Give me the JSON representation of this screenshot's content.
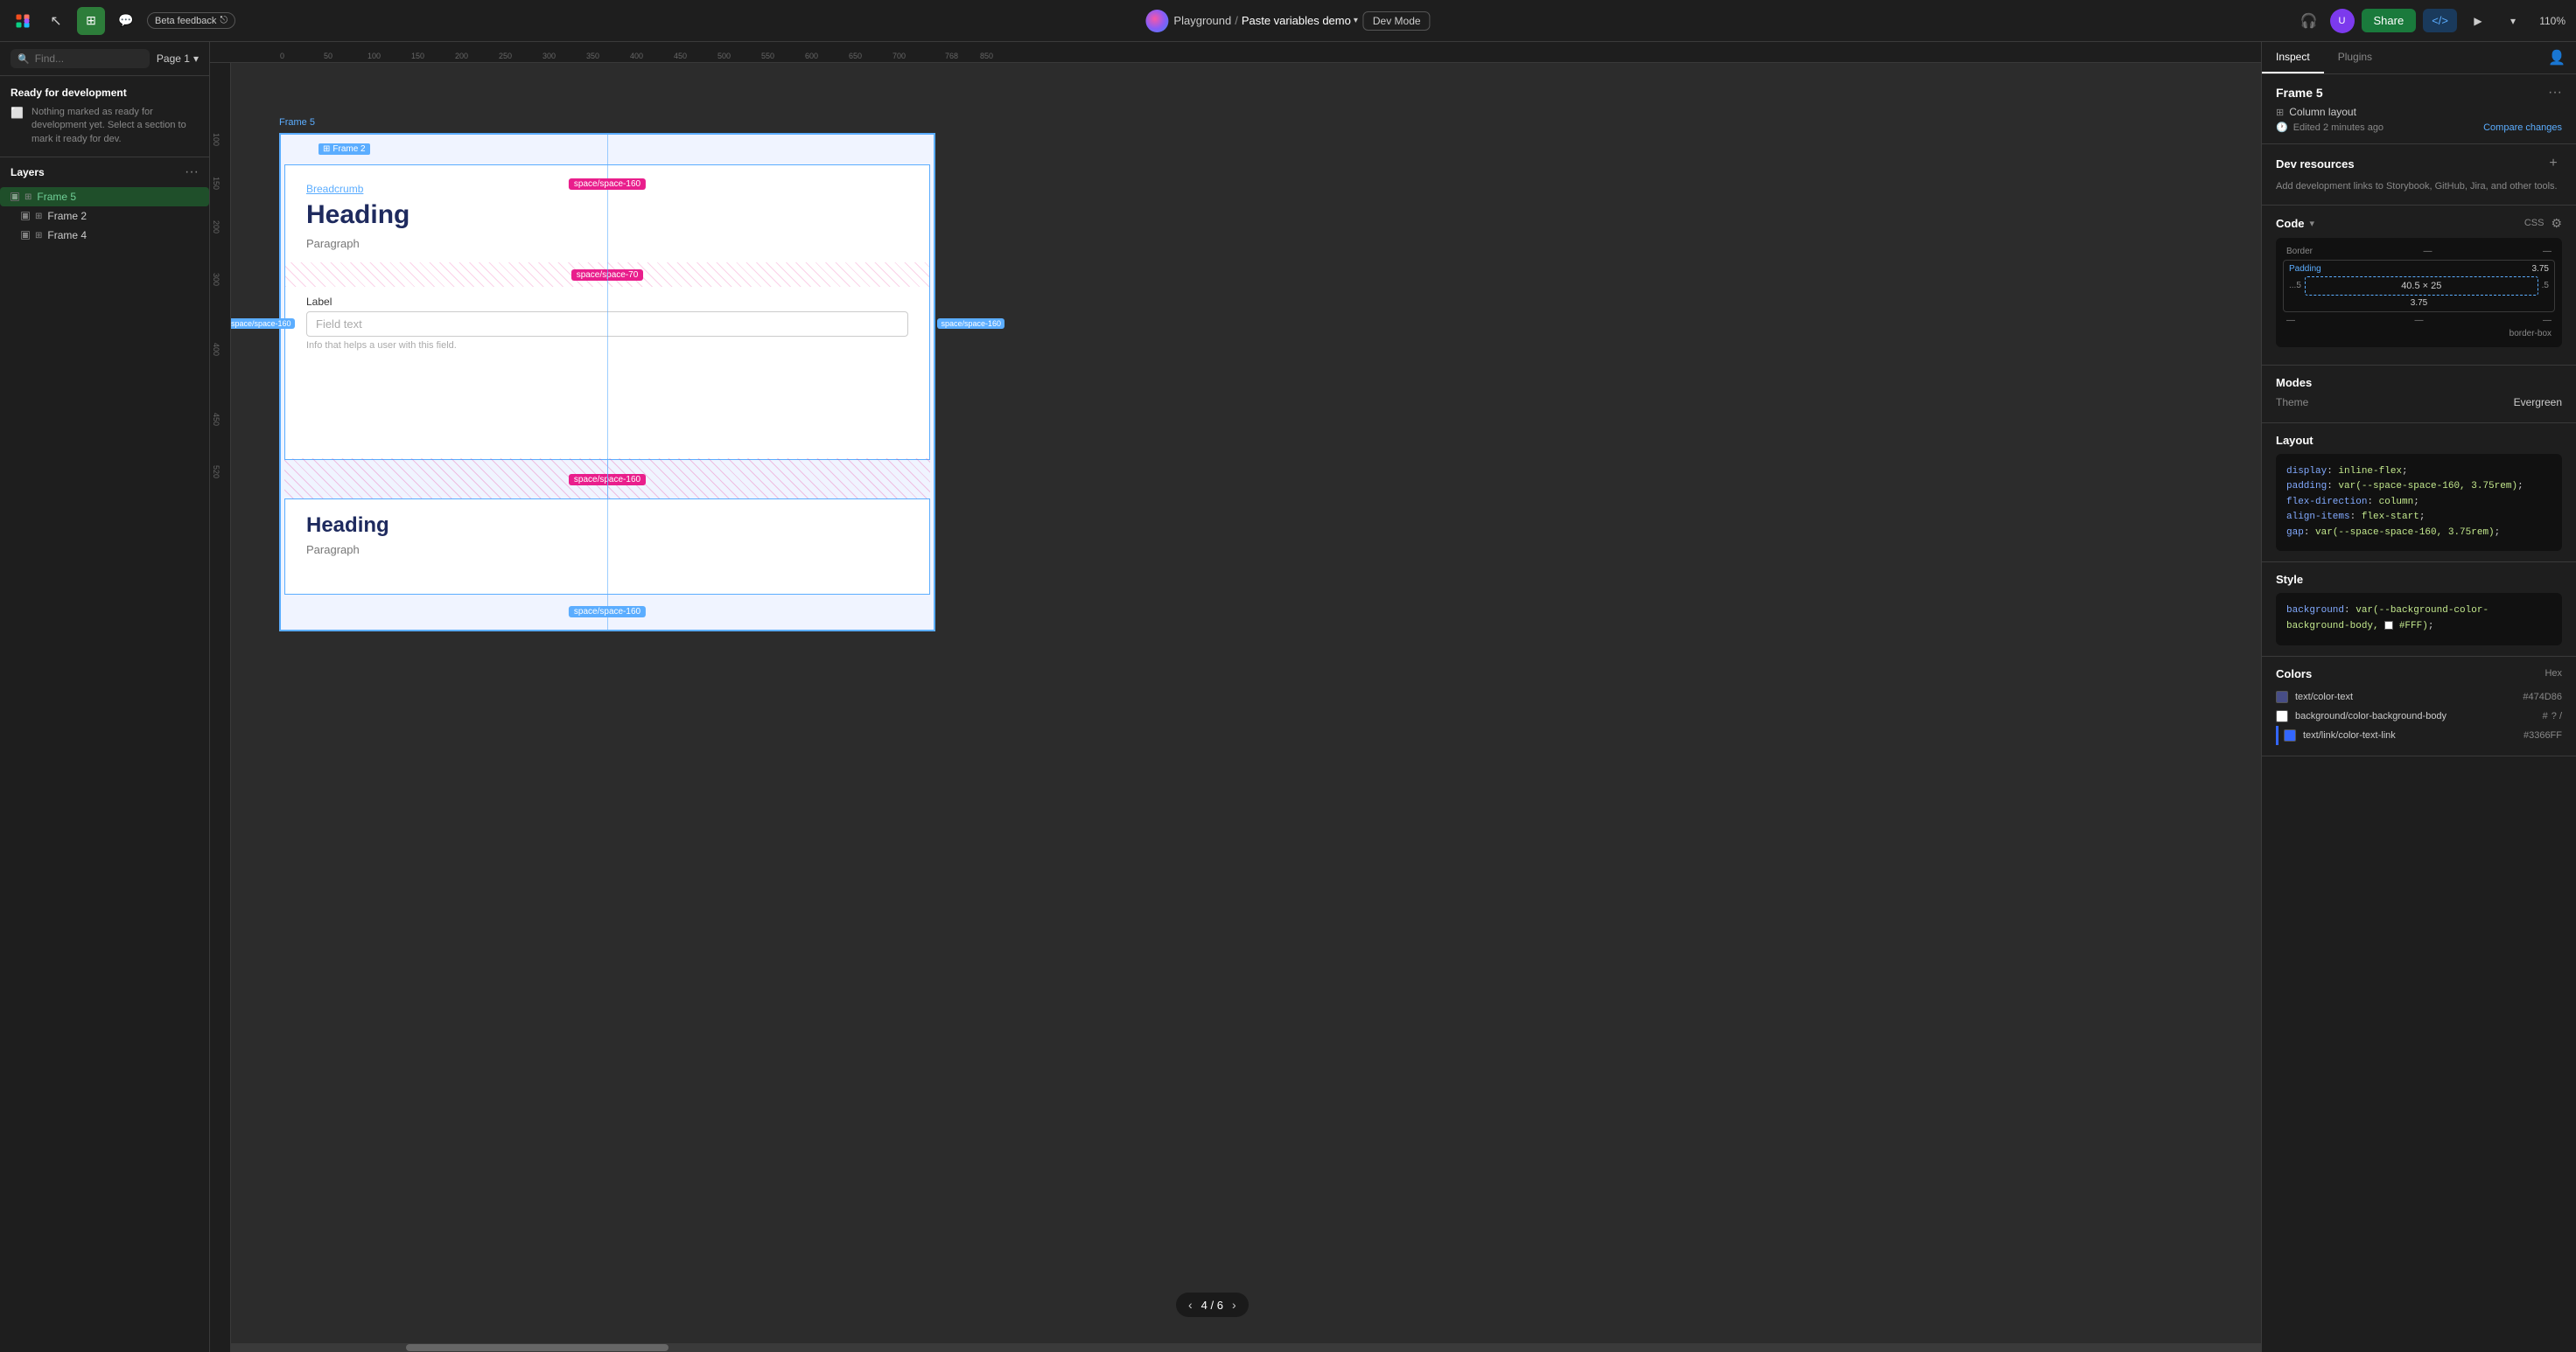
{
  "topbar": {
    "beta_label": "Beta feedback",
    "project": "Playground",
    "separator": "/",
    "file": "Paste variables demo",
    "dev_mode": "Dev Mode",
    "share": "Share",
    "zoom": "110%"
  },
  "left_panel": {
    "search_placeholder": "Find...",
    "page": "Page 1",
    "ready_dev_title": "Ready for development",
    "ready_dev_text": "Nothing marked as ready for development yet. Select a section to mark it ready for dev.",
    "layers_title": "Layers",
    "layers": [
      {
        "id": "frame5",
        "name": "Frame 5",
        "level": 0,
        "selected": true
      },
      {
        "id": "frame2",
        "name": "Frame 2",
        "level": 1,
        "selected": false
      },
      {
        "id": "frame4",
        "name": "Frame 4",
        "level": 1,
        "selected": false
      }
    ]
  },
  "canvas": {
    "frame_label": "Frame 5",
    "frame2_label": "Frame 2",
    "space_top": "space/space-160",
    "space_mid1": "space/space-70",
    "space_left": "space/space-160",
    "space_right": "space/space-160",
    "space_bottom": "space/space-160",
    "space_mid2": "space/space-160",
    "breadcrumb": "Breadcrumb",
    "heading1": "Heading",
    "paragraph1": "Paragraph",
    "label": "Label",
    "field_text": "Field text",
    "helper_text": "Info that helps a user with this field.",
    "heading2": "Heading",
    "paragraph2": "Paragraph",
    "page_indicator": "4 / 6"
  },
  "right_panel": {
    "tabs": [
      "Inspect",
      "Plugins"
    ],
    "active_tab": "Inspect",
    "frame_title": "Frame 5",
    "frame_layout": "Column layout",
    "frame_edited": "Edited 2 minutes ago",
    "compare_changes": "Compare changes",
    "dev_resources_title": "Dev resources",
    "dev_resources_text": "Add development links to Storybook, GitHub, Jira, and other tools.",
    "code_label": "Code",
    "code_lang": "CSS",
    "box_model": {
      "border_label": "Border",
      "padding_label": "Padding",
      "padding_value": "3.75",
      "size": "40.5 × 25",
      "left": "...5",
      "right": ".5",
      "bottom_label": "3.75",
      "border_box": "border-box"
    },
    "modes_title": "Modes",
    "theme_label": "Theme",
    "theme_value": "Evergreen",
    "layout_title": "Layout",
    "layout_code": [
      "display: inline-flex;",
      "padding: var(--space-space-160, 3.75rem);",
      "flex-direction: column;",
      "align-items: flex-start;",
      "gap: var(--space-space-160, 3.75rem);"
    ],
    "style_title": "Style",
    "style_code": "background: var(--background-color-background-body, #FFF);",
    "colors_title": "Colors",
    "hex_label": "Hex",
    "colors": [
      {
        "name": "text/color-text",
        "hex": "#474D86",
        "swatch": "#474D86"
      },
      {
        "name": "background/color-background-body",
        "hex": "#",
        "swatch": "#FFFFFF",
        "icons": "? /"
      },
      {
        "name": "text/link/color-text-link",
        "hex": "#3366FF",
        "swatch": "#3366FF"
      }
    ]
  }
}
